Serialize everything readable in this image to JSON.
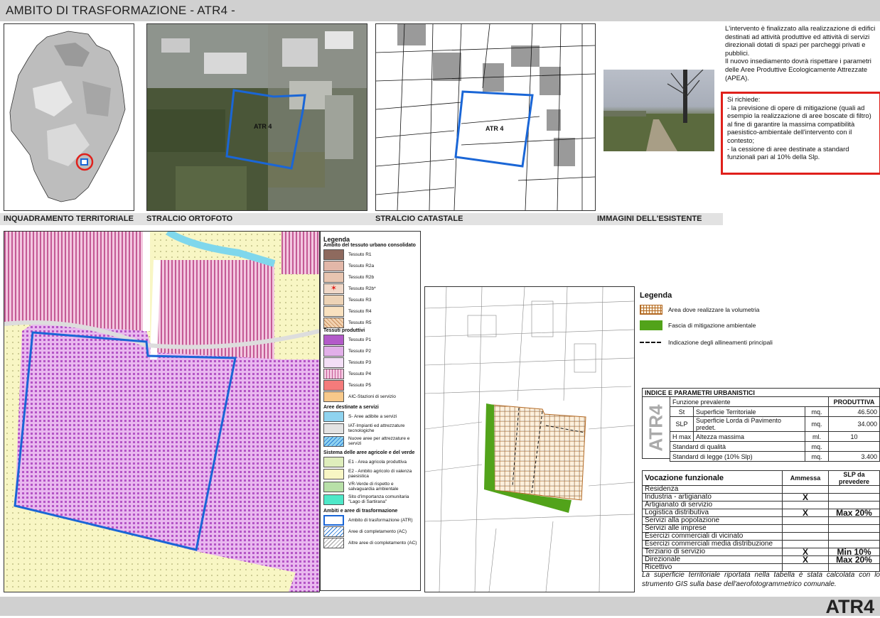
{
  "header": {
    "title": "AMBITO DI TRASFORMAZIONE - ATR4 -"
  },
  "footer": {
    "code": "ATR4"
  },
  "captions": {
    "territorial": "INQUADRAMENTO TERRITORIALE",
    "ortho": "STRALCIO ORTOFOTO",
    "cadastral": "STRALCIO CATASTALE",
    "existing": "IMMAGINI DELL'ESISTENTE"
  },
  "map_labels": {
    "ortho": "ATR 4",
    "cadastral": "ATR 4"
  },
  "description": {
    "p1": "L'intervento è finalizzato alla realizzazione di edifici destinati ad attività produttive ed attività di servizi direzionali dotati di spazi per parcheggi privati e pubblici.",
    "p2": "Il nuovo insediamento dovrà rispettare i parametri delle Aree Produttive Ecologicamente Attrezzate (APEA).",
    "req_title": "Si richiede:",
    "req1": "- la previsione di opere di mitigazione (quali ad esempio la realizzazione di aree boscate di filtro) al fine di garantire la massima compatibilità paesistico-ambientale dell'intervento con il contesto;",
    "req2": "- la cessione di aree destinate a standard funzionali pari al 10% della Slp."
  },
  "legend1": {
    "title": "Legenda",
    "group1": "Ambito del tessuto urbano consolidato",
    "items1": [
      "Tessuto R1",
      "Tessuto R2a",
      "Tessuto R2b",
      "Tessuto R2b*",
      "Tessuto R3",
      "Tessuto R4",
      "Tessuto R5"
    ],
    "group2": "Tessuti produttivi",
    "items2": [
      "Tessuto P1",
      "Tessuto P2",
      "Tessuto P3",
      "Tessuto P4",
      "Tessuto P5",
      "AIC-Stazioni di servizio"
    ],
    "group3": "Aree destinate a servizi",
    "items3": [
      "S- Aree adibite a servizi",
      "IAT-Impianti ed attrezzature tecnologiche",
      "Nuove aree per attrezzature e servizi"
    ],
    "group4": "Sistema delle aree agricole e del verde",
    "items4": [
      "E1 - Area agricola produttiva",
      "E2 - Ambito agricolo di valenza paesistica",
      "VR-Verde di rispetto e salvaguardia ambientale",
      "Sito d'importanza comunitaria \"Lago di Sartirana\""
    ],
    "group5": "Ambiti e aree di trasformazione",
    "items5": [
      "Ambito di trasformazione (ATR)",
      "Aree di completamento (AC)",
      "Altre aree di completamento (AC)"
    ]
  },
  "legend2": {
    "title": "Legenda",
    "items": [
      "Area dove realizzare la volumetria",
      "Fascia di mitigazione ambientale",
      "Indicazione degli allineamenti principali"
    ]
  },
  "index_table": {
    "title": "INDICE E PARAMETRI URBANISTICI",
    "side": "ATR4",
    "head": [
      "Funzione prevalente",
      "PRODUTTIVA"
    ],
    "rows": [
      {
        "code": "St",
        "label": "Superficie Territoriale",
        "unit": "mq.",
        "value": "46.500"
      },
      {
        "code": "SLP",
        "label": "Superficie Lorda di Pavimento predet.",
        "unit": "mq.",
        "value": "34.000"
      },
      {
        "code": "H max",
        "label": "Altezza massima",
        "unit": "ml.",
        "value": "10"
      }
    ],
    "rows2": [
      {
        "label": "Standard di qualità",
        "unit": "mq.",
        "value": ""
      },
      {
        "label": "Standard di legge (10% Slp)",
        "unit": "mq.",
        "value": "3.400"
      }
    ]
  },
  "vocation_table": {
    "head": [
      "Vocazione funzionale",
      "Ammessa",
      "SLP da prevedere"
    ],
    "rows": [
      {
        "label": "Residenza",
        "ammessa": "",
        "slp": ""
      },
      {
        "label": "Industria - artigianato",
        "ammessa": "X",
        "slp": ""
      },
      {
        "label": "Artigianato di servizio",
        "ammessa": "",
        "slp": ""
      },
      {
        "label": "Logistica distributiva",
        "ammessa": "X",
        "slp": "Max 20%"
      },
      {
        "label": "Servizi alla popolazione",
        "ammessa": "",
        "slp": ""
      },
      {
        "label": "Servizi alle imprese",
        "ammessa": "",
        "slp": ""
      },
      {
        "label": "Esercizi commerciali di vicinato",
        "ammessa": "",
        "slp": ""
      },
      {
        "label": "Esercizi commerciali media distribuzione",
        "ammessa": "",
        "slp": ""
      },
      {
        "label": "Terziario di servizio",
        "ammessa": "X",
        "slp": "Min 10%"
      },
      {
        "label": "Direzionale",
        "ammessa": "X",
        "slp": "Max 20%"
      },
      {
        "label": "Ricettivo",
        "ammessa": "",
        "slp": ""
      }
    ]
  },
  "note": "La superficie territoriale riportata nella tabella è stata calcolata con lo strumento GIS sulla base dell'aerofotogrammetrico comunale."
}
